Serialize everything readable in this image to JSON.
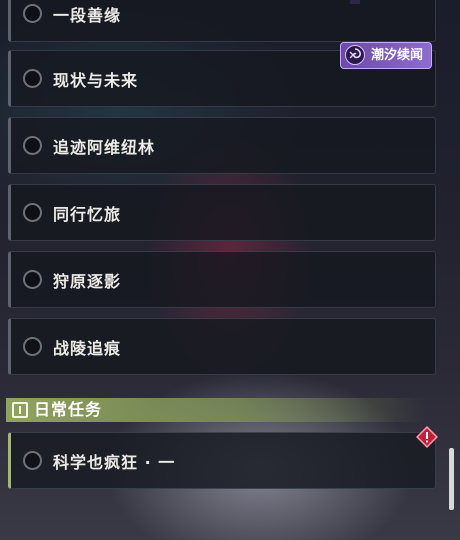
{
  "badge": {
    "label": "潮汐续闻",
    "icon": "tide-swirl-icon",
    "color": "#8e6bd0"
  },
  "quests": [
    {
      "label": "一段善缘"
    },
    {
      "label": "现状与未来"
    },
    {
      "label": "追迹阿维纽林"
    },
    {
      "label": "同行忆旅"
    },
    {
      "label": "狩原逐影"
    },
    {
      "label": "战陵追痕"
    }
  ],
  "daily_section": {
    "title": "日常任务",
    "icon": "quest-board-icon",
    "accent": "#a8b86a",
    "items": [
      {
        "label": "科学也疯狂 · 一",
        "alert_icon": "red-diamond-alert-icon"
      }
    ]
  }
}
